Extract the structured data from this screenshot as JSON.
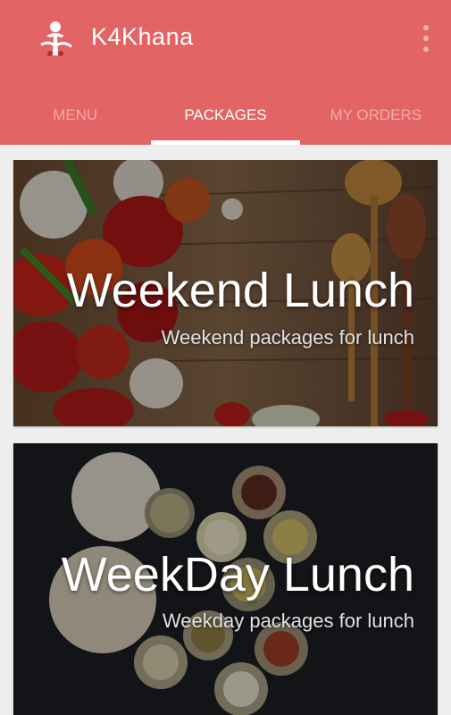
{
  "app": {
    "title": "K4Khana",
    "logo_icon": "chef-logo-icon",
    "overflow_icon": "overflow-menu-icon",
    "brand_color": "#e26464"
  },
  "tabs": [
    {
      "label": "MENU",
      "active": false
    },
    {
      "label": "PACKAGES",
      "active": true
    },
    {
      "label": "MY ORDERS",
      "active": false
    }
  ],
  "packages": [
    {
      "title": "Weekend Lunch",
      "subtitle": "Weekend packages for lunch",
      "image": "vegetables-on-wooden-table"
    },
    {
      "title": "WeekDay Lunch",
      "subtitle": "Weekday packages for lunch",
      "image": "roti-and-dips-on-dark-table"
    }
  ]
}
